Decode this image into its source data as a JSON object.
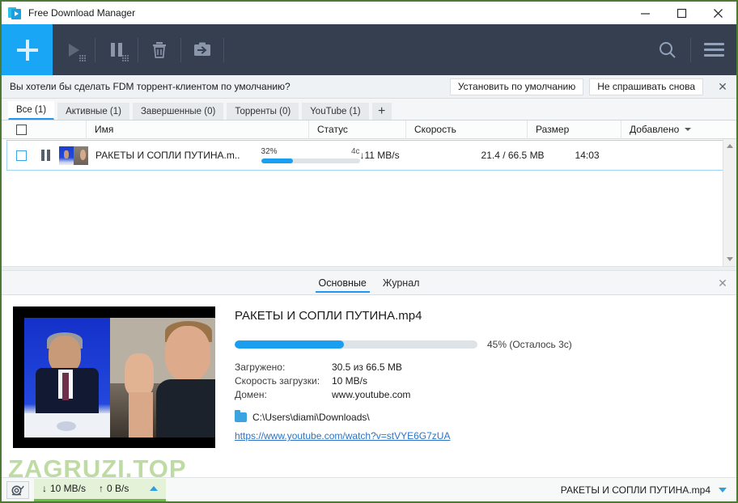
{
  "window": {
    "title": "Free Download Manager",
    "app_icon": "download-arrow-icon",
    "minimize": "minimize-icon",
    "maximize": "maximize-icon",
    "close": "close-icon"
  },
  "toolbar": {
    "add_label": "+",
    "buttons": [
      {
        "name": "start-download-button",
        "icon": "play-icon"
      },
      {
        "name": "pause-download-button",
        "icon": "pause-icon"
      },
      {
        "name": "delete-download-button",
        "icon": "trash-icon"
      },
      {
        "name": "move-download-button",
        "icon": "move-to-folder-icon"
      }
    ],
    "search_icon": "search-icon",
    "menu_icon": "hamburger-menu-icon"
  },
  "notification": {
    "message": "Вы хотели бы сделать FDM торрент-клиентом по умолчанию?",
    "primary_label": "Установить по умолчанию",
    "secondary_label": "Не спрашивать снова",
    "close_icon": "close-icon"
  },
  "tabs": {
    "items": [
      {
        "label": "Все (1)",
        "active": true
      },
      {
        "label": "Активные (1)",
        "active": false
      },
      {
        "label": "Завершенные (0)",
        "active": false
      },
      {
        "label": "Торренты (0)",
        "active": false
      },
      {
        "label": "YouTube (1)",
        "active": false
      }
    ],
    "add_label": "+"
  },
  "list": {
    "columns": [
      "Имя",
      "Статус",
      "Скорость",
      "Размер",
      "Добавлено"
    ],
    "sort_column": "Добавлено",
    "rows": [
      {
        "name": "РАКЕТЫ И СОПЛИ ПУТИНА.m..",
        "progress_label": "32%",
        "progress_value": 32,
        "eta": "4c",
        "speed": "↓11 MB/s",
        "size": "21.4 / 66.5 MB",
        "added": "14:03",
        "state_icon": "pause-icon",
        "thumbnail": "video-thumbnail"
      }
    ]
  },
  "details": {
    "tabs": [
      {
        "label": "Основные",
        "active": true
      },
      {
        "label": "Журнал",
        "active": false
      }
    ],
    "close_icon": "close-icon",
    "thumbnail": "video-thumbnail",
    "file_title": "РАКЕТЫ И СОПЛИ ПУТИНА.mp4",
    "progress_value": 45,
    "progress_text": "45% (Осталось 3c)",
    "fields": [
      {
        "key": "Загружено:",
        "value": "30.5 из 66.5 MB"
      },
      {
        "key": "Скорость загрузки:",
        "value": "10 MB/s"
      },
      {
        "key": "Домен:",
        "value": "www.youtube.com"
      }
    ],
    "folder_icon": "folder-icon",
    "path": "C:\\Users\\diami\\Downloads\\",
    "url": "https://www.youtube.com/watch?v=stVYE6G7zUA"
  },
  "statusbar": {
    "speed_limit_icon": "snail-icon",
    "download_speed": "10 MB/s",
    "upload_speed": "0 B/s",
    "download_arrow": "↓",
    "upload_arrow": "↑",
    "expand_icon": "chevron-up-icon",
    "current_file": "РАКЕТЫ И СОПЛИ ПУТИНА.mp4",
    "dropdown_icon": "chevron-down-icon"
  },
  "watermark": {
    "text": "ZAGRUZI.TOP"
  },
  "colors": {
    "accent_blue": "#19a7f5",
    "toolbar_dark": "#363f4f",
    "progress_blue": "#1a9ef0",
    "status_green": "#6dbe45",
    "link_blue": "#2a73c8"
  }
}
